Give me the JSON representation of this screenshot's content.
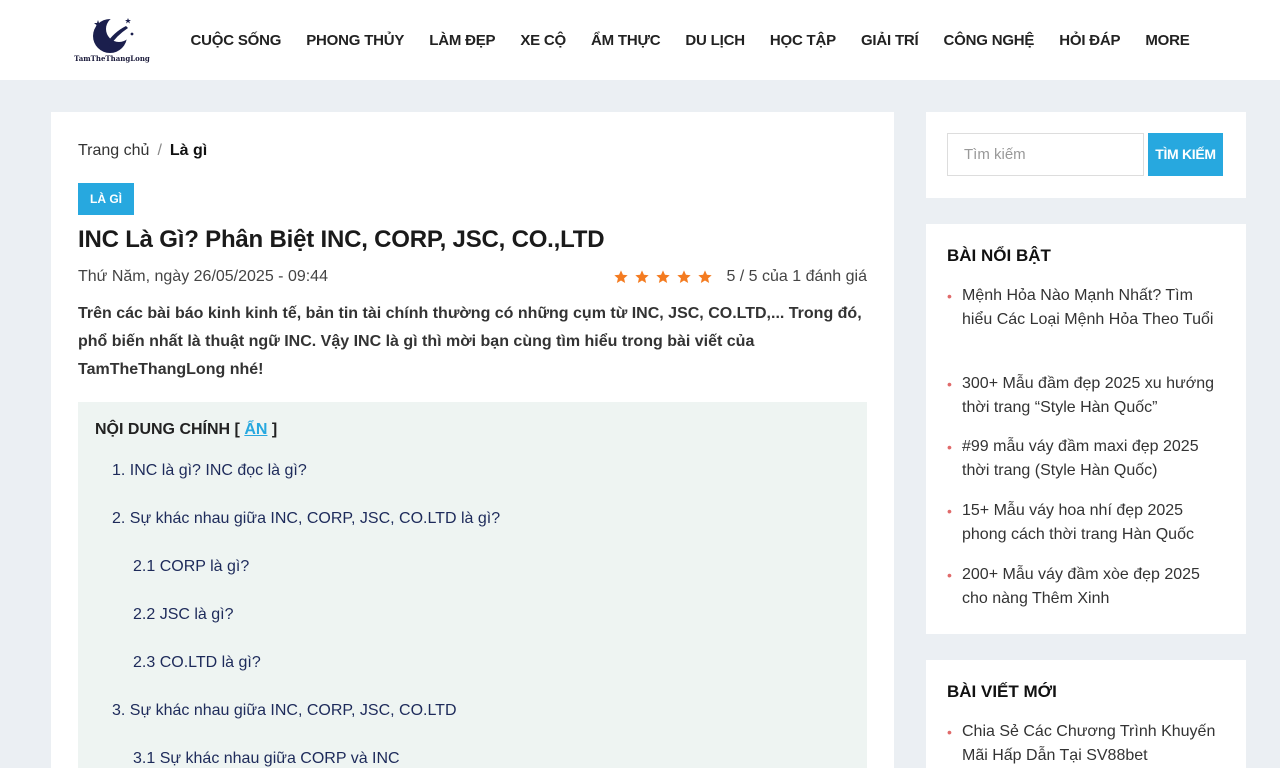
{
  "logo": {
    "text": "TamTheThangLong"
  },
  "nav": [
    "CUỘC SỐNG",
    "PHONG THỦY",
    "LÀM ĐẸP",
    "XE CỘ",
    "ẨM THỰC",
    "DU LỊCH",
    "HỌC TẬP",
    "GIẢI TRÍ",
    "CÔNG NGHỆ",
    "HỎI ĐÁP",
    "MORE"
  ],
  "breadcrumb": {
    "home": "Trang chủ",
    "separator": "/",
    "current": "Là gì"
  },
  "article": {
    "category": "LÀ GÌ",
    "title": "INC Là Gì? Phân Biệt INC, CORP, JSC, CO.,LTD",
    "date": "Thứ Năm, ngày 26/05/2025 - 09:44",
    "rating": {
      "stars": 5,
      "text": "5 / 5 của 1 đánh giá"
    },
    "intro": "Trên các bài báo kinh kinh tế, bản tin tài chính thường có những cụm từ INC, JSC, CO.LTD,... Trong đó, phổ biến nhất là thuật ngữ INC. Vậy INC là gì thì mời bạn cùng tìm hiểu trong bài viết của TamTheThangLong nhé!"
  },
  "toc": {
    "title": "NỘI DUNG CHÍNH [",
    "toggle": "ẨN",
    "close": "]",
    "items": [
      "1. INC là gì? INC đọc là gì?",
      "2. Sự khác nhau giữa INC, CORP, JSC, CO.LTD là gì?",
      "2.1 CORP là gì?",
      "2.2 JSC là gì?",
      "2.3 CO.LTD là gì?",
      "3. Sự khác nhau giữa INC, CORP, JSC, CO.LTD",
      "3.1 Sự khác nhau giữa CORP và INC"
    ]
  },
  "search": {
    "placeholder": "Tìm kiếm",
    "button": "TÌM KIẾM"
  },
  "featured": {
    "title": "BÀI NỔI BẬT",
    "posts": [
      "Mệnh Hỏa Nào Mạnh Nhất? Tìm hiểu Các Loại Mệnh Hỏa Theo Tuổi",
      "300+ Mẫu đầm đẹp 2025 xu hướng thời trang “Style Hàn Quốc”",
      "#99 mẫu váy đầm maxi đẹp 2025 thời trang (Style Hàn Quốc)",
      "15+ Mẫu váy hoa nhí đẹp 2025 phong cách thời trang Hàn Quốc",
      "200+ Mẫu váy đầm xòe đẹp 2025 cho nàng Thêm Xinh"
    ]
  },
  "latest": {
    "title": "BÀI VIẾT MỚI",
    "posts": [
      "Chia Sẻ Các Chương Trình Khuyến Mãi Hấp Dẫn Tại SV88bet"
    ]
  },
  "colors": {
    "accent": "#27a8df",
    "star": "#f47b20",
    "bullet": "#e06a6a",
    "toc_bg": "#eef4f2",
    "page_bg": "#ebeff3"
  }
}
